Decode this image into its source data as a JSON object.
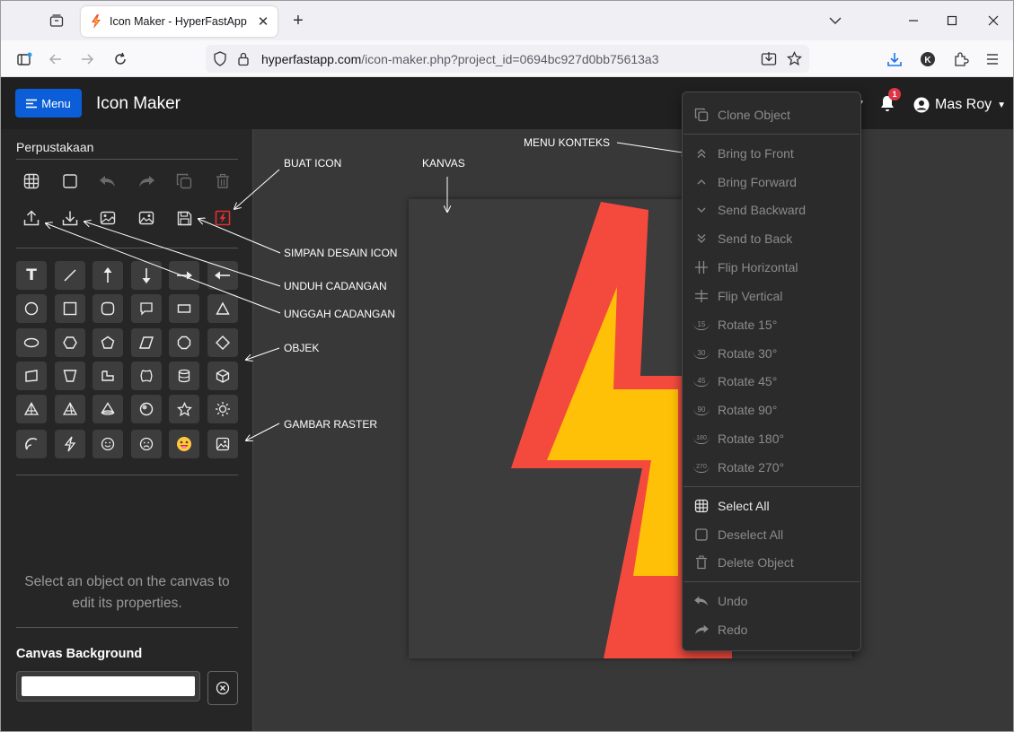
{
  "browser": {
    "tab_title": "Icon Maker - HyperFastApp",
    "url_host": "hyperfastapp.com",
    "url_rest": "/icon-maker.php?project_id=0694bc927d0bb75613a3"
  },
  "app": {
    "menu_label": "Menu",
    "title": "Icon Maker",
    "notification_count": "1",
    "user_name": "Mas Roy"
  },
  "sidebar": {
    "title": "Perpustakaan",
    "placeholder": "Select an object on the canvas to edit its properties.",
    "canvas_bg_label": "Canvas Background",
    "canvas_bg_value": "#ffffff"
  },
  "annotations": {
    "buat_icon": "BUAT ICON",
    "kanvas": "KANVAS",
    "menu_konteks": "MENU KONTEKS",
    "simpan": "SIMPAN DESAIN ICON",
    "unduh": "UNDUH CADANGAN",
    "unggah": "UNGGAH CADANGAN",
    "objek": "OBJEK",
    "gambar": "GAMBAR RASTER"
  },
  "context_menu": {
    "clone": "Clone Object",
    "bring_front": "Bring to Front",
    "bring_forward": "Bring Forward",
    "send_backward": "Send Backward",
    "send_back": "Send to Back",
    "flip_h": "Flip Horizontal",
    "flip_v": "Flip Vertical",
    "rot15": "Rotate 15°",
    "rot30": "Rotate 30°",
    "rot45": "Rotate 45°",
    "rot90": "Rotate 90°",
    "rot180": "Rotate 180°",
    "rot270": "Rotate 270°",
    "select_all": "Select All",
    "deselect_all": "Deselect All",
    "delete": "Delete Object",
    "undo": "Undo",
    "redo": "Redo",
    "rot15_ic": "15",
    "rot30_ic": "30",
    "rot45_ic": "45",
    "rot90_ic": "90",
    "rot180_ic": "180",
    "rot270_ic": "270"
  },
  "colors": {
    "bolt_outer": "#f44a3e",
    "bolt_inner": "#ffc107",
    "accent": "#0b5ed7"
  }
}
